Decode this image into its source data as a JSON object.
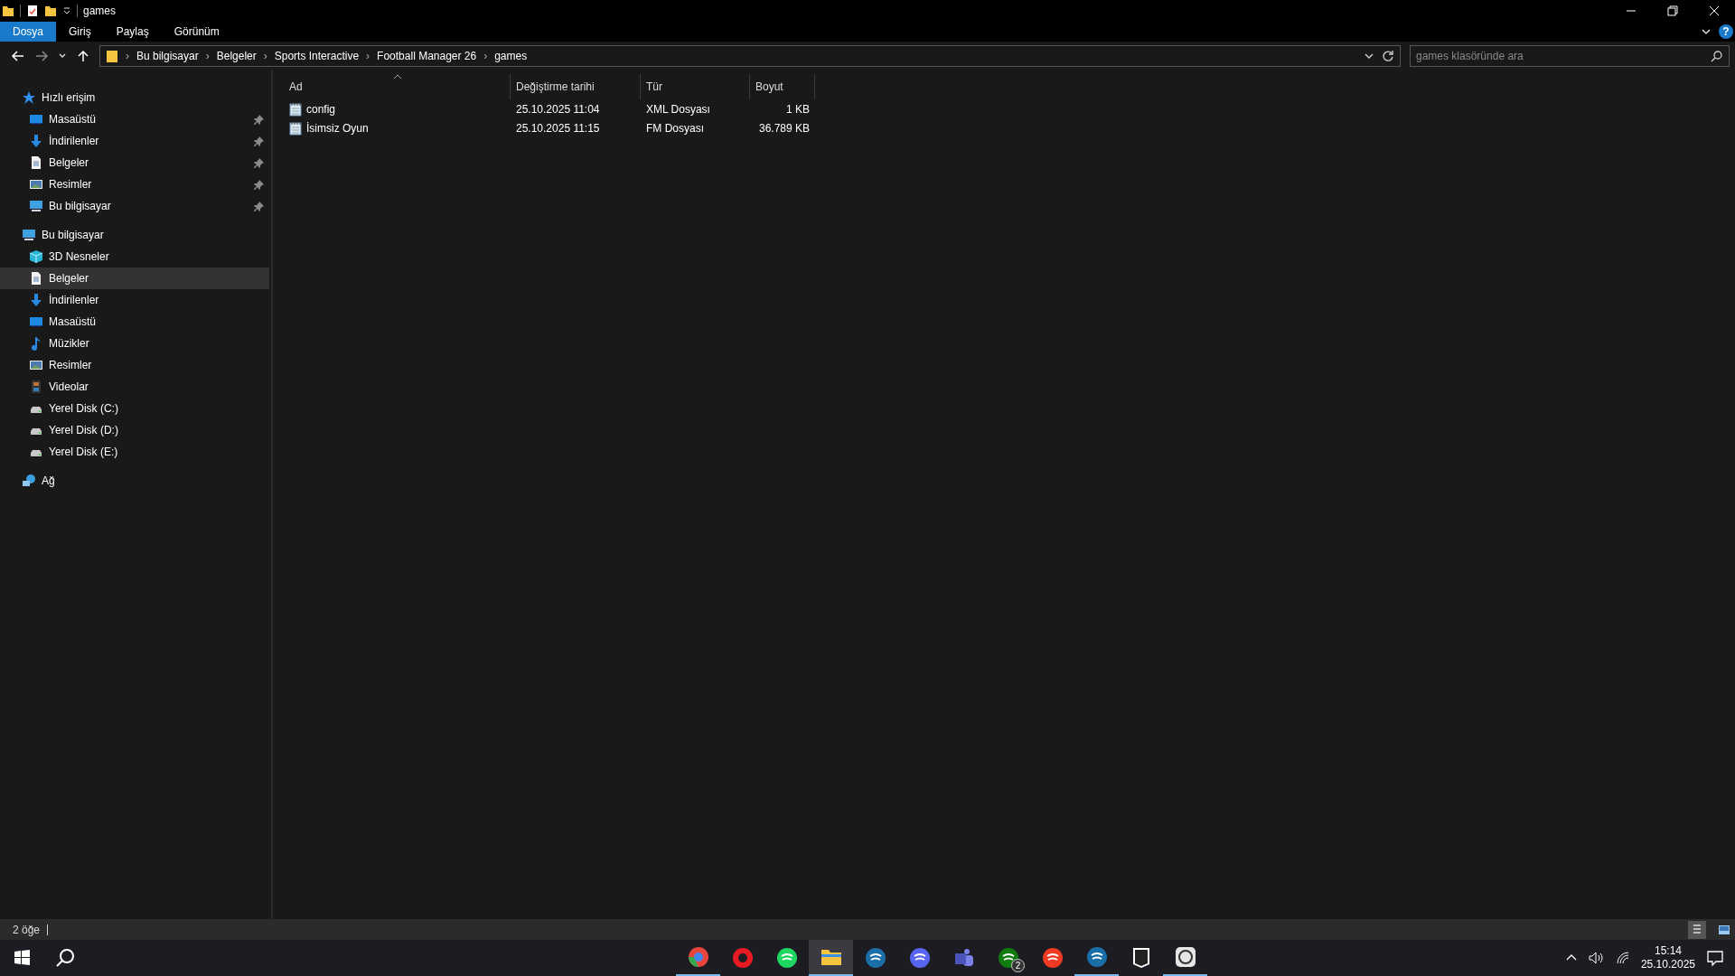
{
  "window": {
    "title": "games"
  },
  "ribbon": {
    "tabs": [
      {
        "label": "Dosya",
        "selected": true
      },
      {
        "label": "Giriş",
        "selected": false
      },
      {
        "label": "Paylaş",
        "selected": false
      },
      {
        "label": "Görünüm",
        "selected": false
      }
    ],
    "help_label": "?"
  },
  "address": {
    "crumbs": [
      "Bu bilgisayar",
      "Belgeler",
      "Sports Interactive",
      "Football Manager 26",
      "games"
    ],
    "separator": "›"
  },
  "search": {
    "placeholder": "games klasöründe ara"
  },
  "sidebar": [
    {
      "label": "Hızlı erişim",
      "kind": "star",
      "selected": false,
      "children": [
        {
          "label": "Masaüstü",
          "kind": "desktop",
          "pinned": true,
          "selected": false
        },
        {
          "label": "İndirilenler",
          "kind": "download",
          "pinned": true,
          "selected": false
        },
        {
          "label": "Belgeler",
          "kind": "docs",
          "pinned": true,
          "selected": false
        },
        {
          "label": "Resimler",
          "kind": "pictures",
          "pinned": true,
          "selected": false
        },
        {
          "label": "Bu bilgisayar",
          "kind": "computer",
          "pinned": true,
          "selected": false
        }
      ]
    },
    {
      "label": "Bu bilgisayar",
      "kind": "computer",
      "selected": false,
      "children": [
        {
          "label": "3D Nesneler",
          "kind": "cube",
          "pinned": false,
          "selected": false
        },
        {
          "label": "Belgeler",
          "kind": "docs",
          "pinned": false,
          "selected": true
        },
        {
          "label": "İndirilenler",
          "kind": "download",
          "pinned": false,
          "selected": false
        },
        {
          "label": "Masaüstü",
          "kind": "desktop",
          "pinned": false,
          "selected": false
        },
        {
          "label": "Müzikler",
          "kind": "music",
          "pinned": false,
          "selected": false
        },
        {
          "label": "Resimler",
          "kind": "pictures",
          "pinned": false,
          "selected": false
        },
        {
          "label": "Videolar",
          "kind": "video",
          "pinned": false,
          "selected": false
        },
        {
          "label": "Yerel Disk (C:)",
          "kind": "disk",
          "pinned": false,
          "selected": false
        },
        {
          "label": "Yerel Disk (D:)",
          "kind": "disk",
          "pinned": false,
          "selected": false
        },
        {
          "label": "Yerel Disk (E:)",
          "kind": "disk",
          "pinned": false,
          "selected": false
        }
      ]
    },
    {
      "label": "Ağ",
      "kind": "network",
      "selected": false
    }
  ],
  "table": {
    "columns": [
      "Ad",
      "Değiştirme tarihi",
      "Tür",
      "Boyut"
    ],
    "rows": [
      {
        "name": "config",
        "date": "25.10.2025 11:04",
        "type": "XML Dosyası",
        "size": "1 KB",
        "selected": false
      },
      {
        "name": "İsimsiz Oyun",
        "date": "25.10.2025 11:15",
        "type": "FM Dosyası",
        "size": "36.789 KB",
        "selected": false
      }
    ]
  },
  "status_bar": {
    "count": "2 öğe",
    "views": [
      {
        "kind": "details",
        "selected": true
      },
      {
        "kind": "icons",
        "selected": false
      }
    ]
  },
  "taskbar": {
    "apps": [
      {
        "kind": "chrome",
        "running": true,
        "active": false
      },
      {
        "kind": "opera",
        "running": false,
        "active": false
      },
      {
        "kind": "spotify",
        "running": false,
        "active": false
      },
      {
        "kind": "explorer",
        "running": true,
        "active": true
      },
      {
        "kind": "steam",
        "running": false,
        "active": false
      },
      {
        "kind": "discord",
        "running": false,
        "active": false
      },
      {
        "kind": "teams",
        "running": false,
        "active": false
      },
      {
        "kind": "xbox",
        "running": false,
        "active": false,
        "badge": "2"
      },
      {
        "kind": "ea",
        "running": false,
        "active": false
      },
      {
        "kind": "steam",
        "running": true,
        "active": false
      },
      {
        "kind": "epic",
        "running": false,
        "active": false
      },
      {
        "kind": "globe",
        "running": true,
        "active": false
      }
    ],
    "time": "15:14",
    "date": "25.10.2025"
  }
}
